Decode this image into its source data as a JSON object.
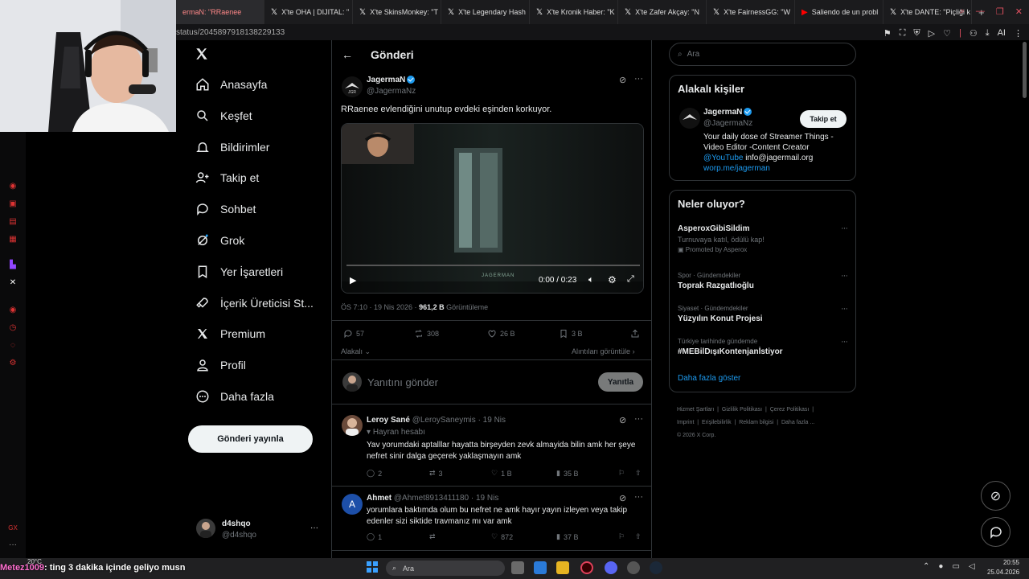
{
  "browser": {
    "tabs": [
      {
        "label": "ermaN: \"RRaenee",
        "active": true
      },
      {
        "label": "X'te OHA | DIJITAL: \""
      },
      {
        "label": "X'te SkinsMonkey: \"T"
      },
      {
        "label": "X'te Legendary Hash"
      },
      {
        "label": "X'te Kronik Haber: \"K"
      },
      {
        "label": "X'te Zafer Akçay: \"N"
      },
      {
        "label": "X'te FairnessGG: \"W"
      },
      {
        "label": "Saliendo de un probl",
        "youtube": true
      },
      {
        "label": "X'te DANTE: \"Piçliği k"
      }
    ],
    "new_tab": "+",
    "url": "status/2045897918138229133",
    "ai_label": "AI"
  },
  "nav": {
    "items": [
      {
        "label": "Anasayfa",
        "icon": "home-icon"
      },
      {
        "label": "Keşfet",
        "icon": "search-icon"
      },
      {
        "label": "Bildirimler",
        "icon": "bell-icon"
      },
      {
        "label": "Takip et",
        "icon": "follow-icon"
      },
      {
        "label": "Sohbet",
        "icon": "chat-icon"
      },
      {
        "label": "Grok",
        "icon": "grok-icon"
      },
      {
        "label": "Yer İşaretleri",
        "icon": "bookmark-icon"
      },
      {
        "label": "İçerik Üreticisi St...",
        "icon": "rocket-icon"
      },
      {
        "label": "Premium",
        "icon": "x-icon"
      },
      {
        "label": "Profil",
        "icon": "profile-icon"
      },
      {
        "label": "Daha fazla",
        "icon": "more-icon"
      }
    ],
    "post_button": "Gönderi yayınla",
    "account": {
      "name": "d4shqo",
      "handle": "@d4shqo",
      "more": "···"
    }
  },
  "post": {
    "header_title": "Gönderi",
    "author_name": "JagermaN",
    "author_handle": "@JagermaNz",
    "text": "RRaenee evlendiğini unutup evdeki eşinden korkuyor.",
    "video_time": "0:00 / 0:23",
    "video_progress": 0,
    "video_watermark": "JAGERMAN",
    "meta_time": "ÖS 7:10 · 19 Nis 2026 · ",
    "views_value": "961,2 B",
    "views_label": " Görüntüleme",
    "stats": {
      "replies": "57",
      "reposts": "308",
      "likes": "26 B",
      "bookmarks": "3 B"
    },
    "sort_label": "Alakalı",
    "quotes_link": "Alıntıları görüntüle",
    "reply_placeholder": "Yanıtını gönder",
    "reply_button": "Yanıtla"
  },
  "replies": [
    {
      "name": "Leroy Sané",
      "handle": "@LeroySaneymis",
      "date": "· 19 Nis",
      "badge": "Hayran hesabı",
      "text": "Yav yorumdaki aptalllar hayatta birşeyden zevk almayida bilin amk her şeye nefret sinir dalga geçerek yaklaşmayın amk",
      "stats": {
        "replies": "2",
        "reposts": "3",
        "likes": "1 B",
        "views": "35 B"
      }
    },
    {
      "name": "Ahmet",
      "handle": "@Ahmet8913411180",
      "date": "· 19 Nis",
      "avatar_letter": "A",
      "text": "yorumlara baktımda olum bu nefret ne amk hayır yayın izleyen veya takip edenler sizi siktide travmanız mı var amk",
      "stats": {
        "replies": "1",
        "reposts": "",
        "likes": "872",
        "views": "37 B"
      }
    }
  ],
  "right": {
    "search_placeholder": "Ara",
    "related": {
      "title": "Alakalı kişiler",
      "name": "JagermaN",
      "handle": "@JagermaNz",
      "follow": "Takip et",
      "bio_line1": "Your daily dose of Streamer Things -",
      "bio_line2": "Video Editor -Content Creator",
      "bio_yt": "@YouTube",
      "bio_mail": " info@jagermail.org",
      "bio_link": "worp.me/jagerman"
    },
    "trends": {
      "title": "Neler oluyor?",
      "items": [
        {
          "name": "AsperoxGibiSildim",
          "sub": "Turnuvaya katıl, ödülü kap!",
          "promo": "Promoted by Asperox"
        },
        {
          "context": "Spor · Gündemdekiler",
          "name": "Toprak Razgatlıoğlu"
        },
        {
          "context": "Siyaset · Gündemdekiler",
          "name": "Yüzyılın Konut Projesi"
        },
        {
          "context": "Türkiye tarihinde gündemde",
          "name": "#MEBilDışıKontenjanİstiyor"
        }
      ],
      "more": "Daha fazla göster"
    },
    "footer": [
      "Hizmet Şartları",
      "Gizlilik Politikası",
      "Çerez Politikası",
      "Imprint",
      "Erişilebilirlik",
      "Reklam bilgisi",
      "Daha fazla ...",
      "© 2026 X Corp."
    ]
  },
  "overlay": {
    "chat_user": "Metez1009",
    "chat_text": ": ting 3 dakika içinde geliyo musn",
    "side_label": "GX"
  },
  "taskbar": {
    "weather": "20°C",
    "search": "Ara",
    "time": "20:55",
    "date": "25.04.2026"
  },
  "colors": {
    "accent": "#1d9bf0",
    "background": "#000000",
    "browser_accent": "#e0405a"
  }
}
